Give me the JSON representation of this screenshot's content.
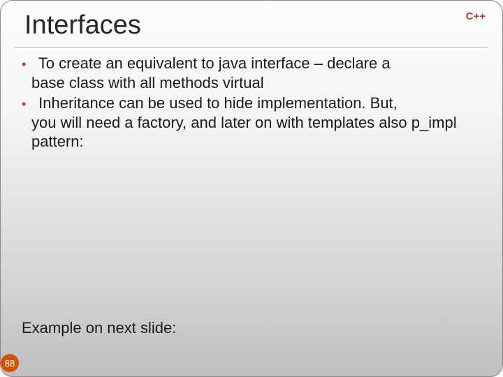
{
  "header": {
    "title": "Interfaces",
    "lang_badge": "C++"
  },
  "bullets": [
    {
      "first": "To create an equivalent to java interface – declare a",
      "cont": "base class with all methods virtual"
    },
    {
      "first": "Inheritance can be used to hide implementation. But,",
      "cont": "you will need a factory, and later on with templates also p_impl pattern:"
    }
  ],
  "footer": {
    "example_note": "Example on next slide:",
    "page_number": "88"
  }
}
